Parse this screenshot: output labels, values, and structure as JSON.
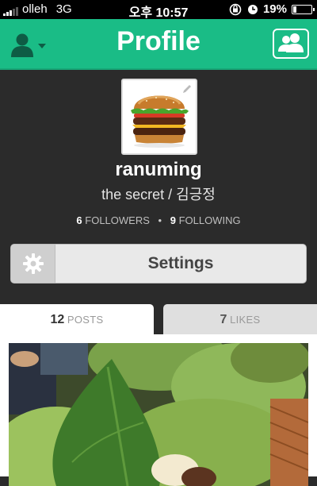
{
  "status_bar": {
    "carrier": "olleh",
    "network": "3G",
    "time": "오후 10:57",
    "battery": "19%",
    "battery_level": 0.19
  },
  "header": {
    "title": "Profile",
    "left_icon": "user-menu-icon",
    "right_icon": "friends-icon"
  },
  "profile": {
    "username": "ranuming",
    "tagline": "the secret / 김긍정",
    "followers_count": "6",
    "followers_label": "FOLLOWERS",
    "following_count": "9",
    "following_label": "FOLLOWING"
  },
  "settings": {
    "label": "Settings",
    "icon": "gear-icon"
  },
  "tabs": [
    {
      "count": "12",
      "label": "POSTS",
      "active": true
    },
    {
      "count": "7",
      "label": "LIKES",
      "active": false
    }
  ],
  "colors": {
    "accent": "#1abc86",
    "background": "#2b2b2b"
  }
}
